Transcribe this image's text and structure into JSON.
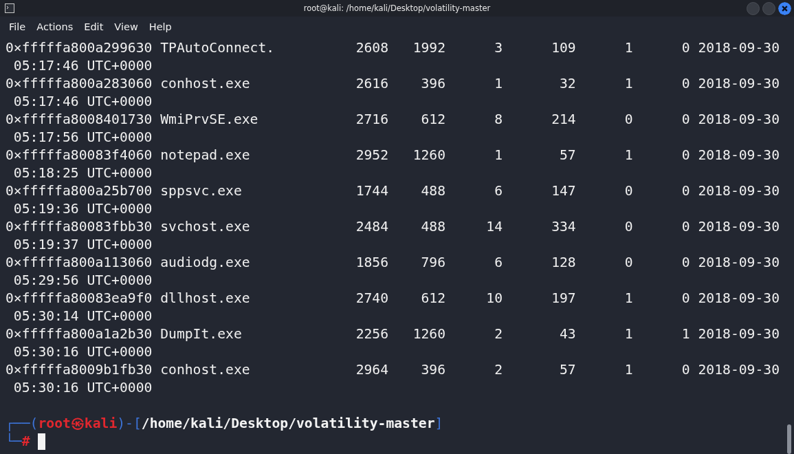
{
  "window": {
    "title": "root@kali: /home/kali/Desktop/volatility-master"
  },
  "menu": [
    "File",
    "Actions",
    "Edit",
    "View",
    "Help"
  ],
  "rows": [
    {
      "offset": "0×fffffa800a299630",
      "name": "TPAutoConnect.",
      "pid": "2608",
      "ppid": "1992",
      "thds": "3",
      "hnds": "109",
      "sess": "1",
      "wow64": "0",
      "date": "2018-09-30",
      "time": "05:17:46 UTC+0000"
    },
    {
      "offset": "0×fffffa800a283060",
      "name": "conhost.exe",
      "pid": "2616",
      "ppid": "396",
      "thds": "1",
      "hnds": "32",
      "sess": "1",
      "wow64": "0",
      "date": "2018-09-30",
      "time": "05:17:46 UTC+0000"
    },
    {
      "offset": "0×fffffa8008401730",
      "name": "WmiPrvSE.exe",
      "pid": "2716",
      "ppid": "612",
      "thds": "8",
      "hnds": "214",
      "sess": "0",
      "wow64": "0",
      "date": "2018-09-30",
      "time": "05:17:56 UTC+0000"
    },
    {
      "offset": "0×fffffa80083f4060",
      "name": "notepad.exe",
      "pid": "2952",
      "ppid": "1260",
      "thds": "1",
      "hnds": "57",
      "sess": "1",
      "wow64": "0",
      "date": "2018-09-30",
      "time": "05:18:25 UTC+0000"
    },
    {
      "offset": "0×fffffa800a25b700",
      "name": "sppsvc.exe",
      "pid": "1744",
      "ppid": "488",
      "thds": "6",
      "hnds": "147",
      "sess": "0",
      "wow64": "0",
      "date": "2018-09-30",
      "time": "05:19:36 UTC+0000"
    },
    {
      "offset": "0×fffffa80083fbb30",
      "name": "svchost.exe",
      "pid": "2484",
      "ppid": "488",
      "thds": "14",
      "hnds": "334",
      "sess": "0",
      "wow64": "0",
      "date": "2018-09-30",
      "time": "05:19:37 UTC+0000"
    },
    {
      "offset": "0×fffffa800a113060",
      "name": "audiodg.exe",
      "pid": "1856",
      "ppid": "796",
      "thds": "6",
      "hnds": "128",
      "sess": "0",
      "wow64": "0",
      "date": "2018-09-30",
      "time": "05:29:56 UTC+0000"
    },
    {
      "offset": "0×fffffa80083ea9f0",
      "name": "dllhost.exe",
      "pid": "2740",
      "ppid": "612",
      "thds": "10",
      "hnds": "197",
      "sess": "1",
      "wow64": "0",
      "date": "2018-09-30",
      "time": "05:30:14 UTC+0000"
    },
    {
      "offset": "0×fffffa800a1a2b30",
      "name": "DumpIt.exe",
      "pid": "2256",
      "ppid": "1260",
      "thds": "2",
      "hnds": "43",
      "sess": "1",
      "wow64": "1",
      "date": "2018-09-30",
      "time": "05:30:16 UTC+0000"
    },
    {
      "offset": "0×fffffa8009b1fb30",
      "name": "conhost.exe",
      "pid": "2964",
      "ppid": "396",
      "thds": "2",
      "hnds": "57",
      "sess": "1",
      "wow64": "0",
      "date": "2018-09-30",
      "time": "05:30:16 UTC+0000"
    }
  ],
  "prompt": {
    "line1": [
      {
        "kind": "frame",
        "text": "┌──("
      },
      {
        "kind": "user",
        "text": "root㉿kali"
      },
      {
        "kind": "frame",
        "text": ")-["
      },
      {
        "kind": "path",
        "text": "/home/kali/Desktop/volatility-master"
      },
      {
        "kind": "frame",
        "text": "]"
      }
    ],
    "line2": [
      {
        "kind": "frame",
        "text": "└─"
      },
      {
        "kind": "user",
        "text": "#"
      }
    ]
  }
}
